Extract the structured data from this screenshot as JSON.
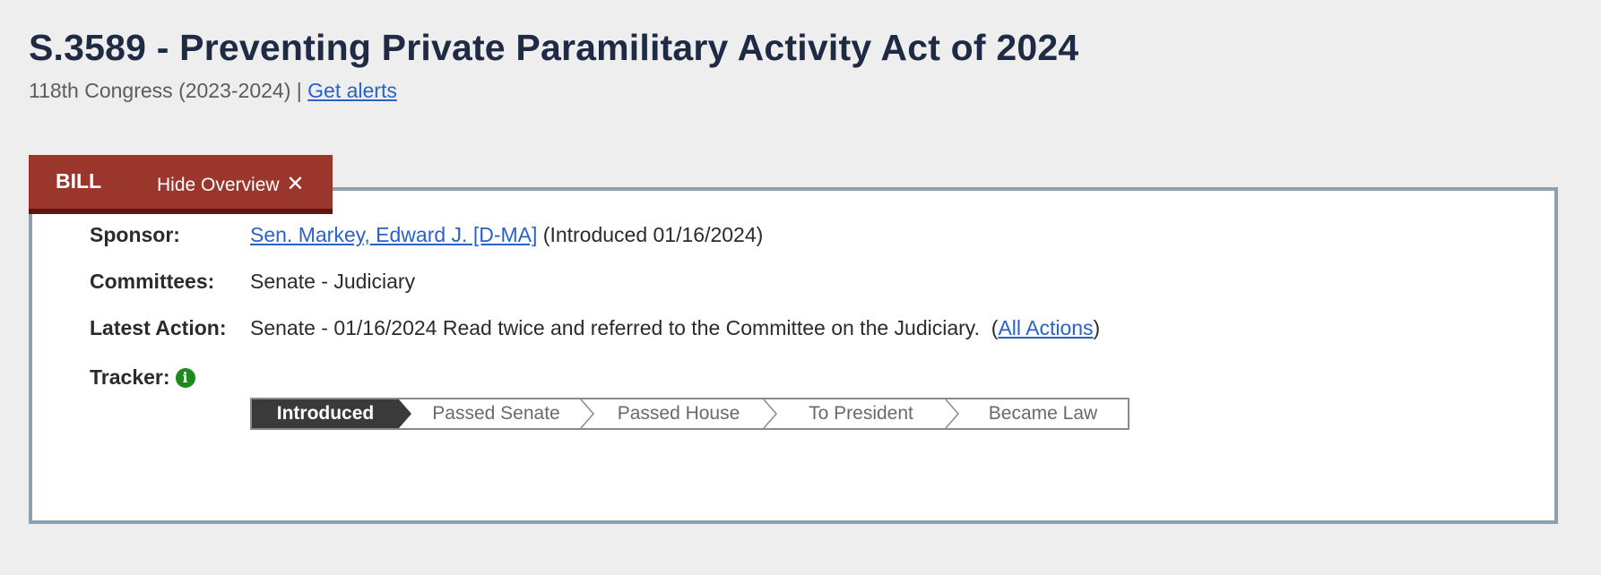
{
  "header": {
    "title": "S.3589 - Preventing Private Paramilitary Activity Act of 2024",
    "congress": "118th Congress (2023-2024) |",
    "alerts_link": "Get alerts"
  },
  "tabs": {
    "bill_label": "BILL",
    "hide_overview_label": "Hide Overview",
    "close_glyph": "✕"
  },
  "overview": {
    "sponsor": {
      "label": "Sponsor:",
      "name_link": "Sen. Markey, Edward J. [D-MA]",
      "introduced": "(Introduced 01/16/2024)"
    },
    "committees": {
      "label": "Committees:",
      "value": "Senate - Judiciary"
    },
    "latest_action": {
      "label": "Latest Action:",
      "text": "Senate - 01/16/2024 Read twice and referred to the Committee on the Judiciary.",
      "open_paren": "(",
      "all_actions_link": "All Actions",
      "close_paren": ")"
    },
    "tracker": {
      "label": "Tracker:",
      "info_glyph": "i",
      "info_icon_color": "#1e8a1e",
      "current_stage_color": "#3a3a3a",
      "stages": [
        "Introduced",
        "Passed Senate",
        "Passed House",
        "To President",
        "Became Law"
      ],
      "current_stage": "Introduced"
    }
  },
  "colors": {
    "tab_background": "#9b362d",
    "link": "#2a62c9",
    "title": "#1f2a44"
  }
}
